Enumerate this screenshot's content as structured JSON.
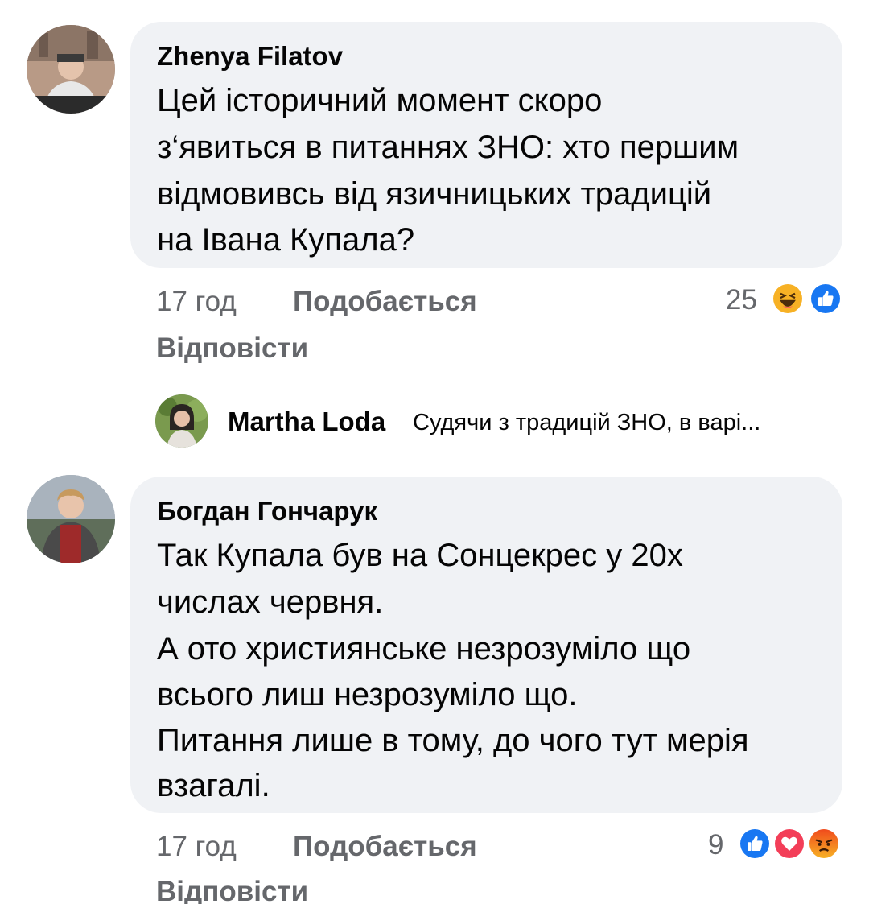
{
  "comments": [
    {
      "author": "Zhenya Filatov",
      "text_lines": [
        "Цей історичний момент скоро",
        "з‘явиться в питаннях ЗНО: хто першим",
        "відмовивсь від язичницьких традицій",
        "на Івана Купала?"
      ],
      "time": "17 год",
      "like_label": "Подобається",
      "reply_label": "Відповісти",
      "reaction_count": "25",
      "reactions": [
        "haha-icon",
        "like-icon"
      ]
    },
    {
      "author": "Богдан Гончарук",
      "text_lines": [
        "Так Купала був на Сонцекрес у 20х",
        "числах червня.",
        "А ото християнське незрозуміло що",
        "всього лиш незрозуміло що.",
        "Питання лише в тому, до чого тут мерія",
        "взагалі."
      ],
      "time": "17 год",
      "like_label": "Подобається",
      "reply_label": "Відповісти",
      "reaction_count": "9",
      "reactions": [
        "like-icon",
        "love-icon",
        "angry-icon"
      ]
    }
  ],
  "reply_preview": {
    "author": "Martha Loda",
    "text": "Судячи з традицій ЗНО, в варі..."
  },
  "colors": {
    "bubble": "#f0f2f5",
    "meta_text": "#65676b",
    "like_blue": "#1877f2",
    "love_red": "#f33e58",
    "haha_yellow": "#f7b125",
    "angry_orange": "#e9710f"
  }
}
